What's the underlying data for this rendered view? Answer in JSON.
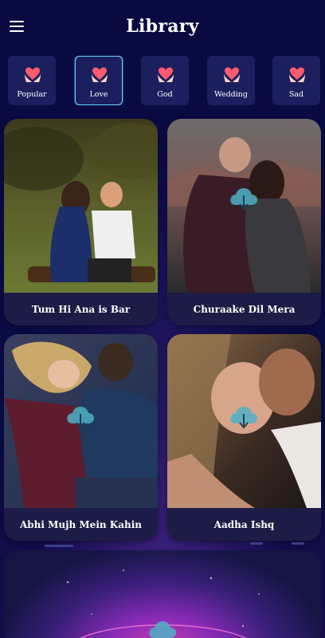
{
  "header": {
    "title": "Library",
    "menu_icon": "hamburger-menu-icon"
  },
  "categories": [
    {
      "label": "Popular",
      "icon": "heart-hands-icon",
      "active": false
    },
    {
      "label": "Love",
      "icon": "heart-hands-icon",
      "active": true
    },
    {
      "label": "God",
      "icon": "heart-hands-icon",
      "active": false
    },
    {
      "label": "Wedding",
      "icon": "heart-hands-icon",
      "active": false
    },
    {
      "label": "Sad",
      "icon": "heart-hands-icon",
      "active": false
    }
  ],
  "songs": [
    {
      "title": "Tum Hi Ana is Bar",
      "download_icon": false
    },
    {
      "title": "Churaake Dil Mera",
      "download_icon": true
    },
    {
      "title": "Abhi Mujh Mein Kahin",
      "download_icon": true
    },
    {
      "title": "Aadha Ishq",
      "download_icon": true
    }
  ],
  "colors": {
    "background": "#08083a",
    "card": "#1d1c47",
    "category_tile": "#1b1f5e",
    "active_border": "#6ad4ff",
    "heart": "#ff5a6e",
    "download_cloud": "#4fb0c6"
  }
}
